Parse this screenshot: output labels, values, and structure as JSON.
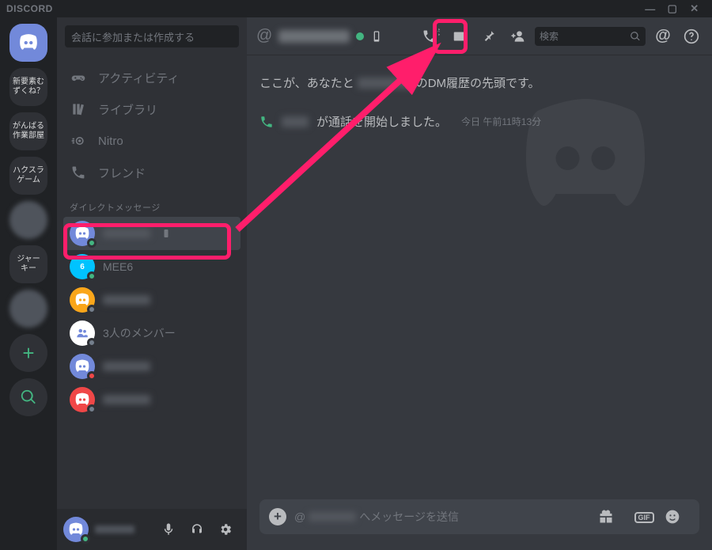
{
  "app_name": "DISCORD",
  "window_buttons": {
    "min": "—",
    "max": "▢",
    "close": "✕"
  },
  "servers": [
    {
      "kind": "home"
    },
    {
      "kind": "txt",
      "label": "新要素む\nずくね？"
    },
    {
      "kind": "txt",
      "label": "がんばる\n作業部屋"
    },
    {
      "kind": "txt",
      "label": "ハクスラ\nゲーム"
    },
    {
      "kind": "img"
    },
    {
      "kind": "txt",
      "label": "ジャー\nキー"
    },
    {
      "kind": "img"
    },
    {
      "kind": "add"
    },
    {
      "kind": "find"
    }
  ],
  "quick_search_placeholder": "会話に参加または作成する",
  "nav": [
    {
      "icon": "gamepad",
      "label": "アクティビティ"
    },
    {
      "icon": "library",
      "label": "ライブラリ"
    },
    {
      "icon": "nitro",
      "label": "Nitro"
    },
    {
      "icon": "friends",
      "label": "フレンド"
    }
  ],
  "dm_header": "ダイレクトメッセージ",
  "dms": [
    {
      "avatar_bg": "#7289da",
      "icon": "discord",
      "status": "#43b581",
      "name_blur": true,
      "phone": true,
      "selected": true
    },
    {
      "avatar_bg": "#00c3ff",
      "icon": "mee6",
      "status": "#43b581",
      "label": "MEE6"
    },
    {
      "avatar_bg": "#faa61a",
      "icon": "discord",
      "status": "#747f8d",
      "name_blur": true
    },
    {
      "avatar_bg": "#ffffff",
      "icon": "group",
      "status": "#747f8d",
      "label": "3人のメンバー"
    },
    {
      "avatar_bg": "#7289da",
      "icon": "discord",
      "status": "#f04747",
      "name_blur": true
    },
    {
      "avatar_bg": "#f04747",
      "icon": "discord",
      "status": "#747f8d",
      "name_blur": true
    }
  ],
  "userbar": {
    "avatar_bg": "#7289da",
    "status": "#43b581"
  },
  "chat_header": {
    "status_online": true,
    "search_placeholder": "検索"
  },
  "dm_start": {
    "pre": "ここが、あなたと",
    "post": "のDM履歴の先頭です。"
  },
  "call_line": {
    "text": "が通話を開始しました。",
    "timestamp": "今日 午前11時13分"
  },
  "composer": {
    "prefix": "@",
    "suffix": "へメッセージを送信",
    "gif": "GIF"
  },
  "colors": {
    "accent": "#ff1e6b",
    "online": "#43b581"
  }
}
